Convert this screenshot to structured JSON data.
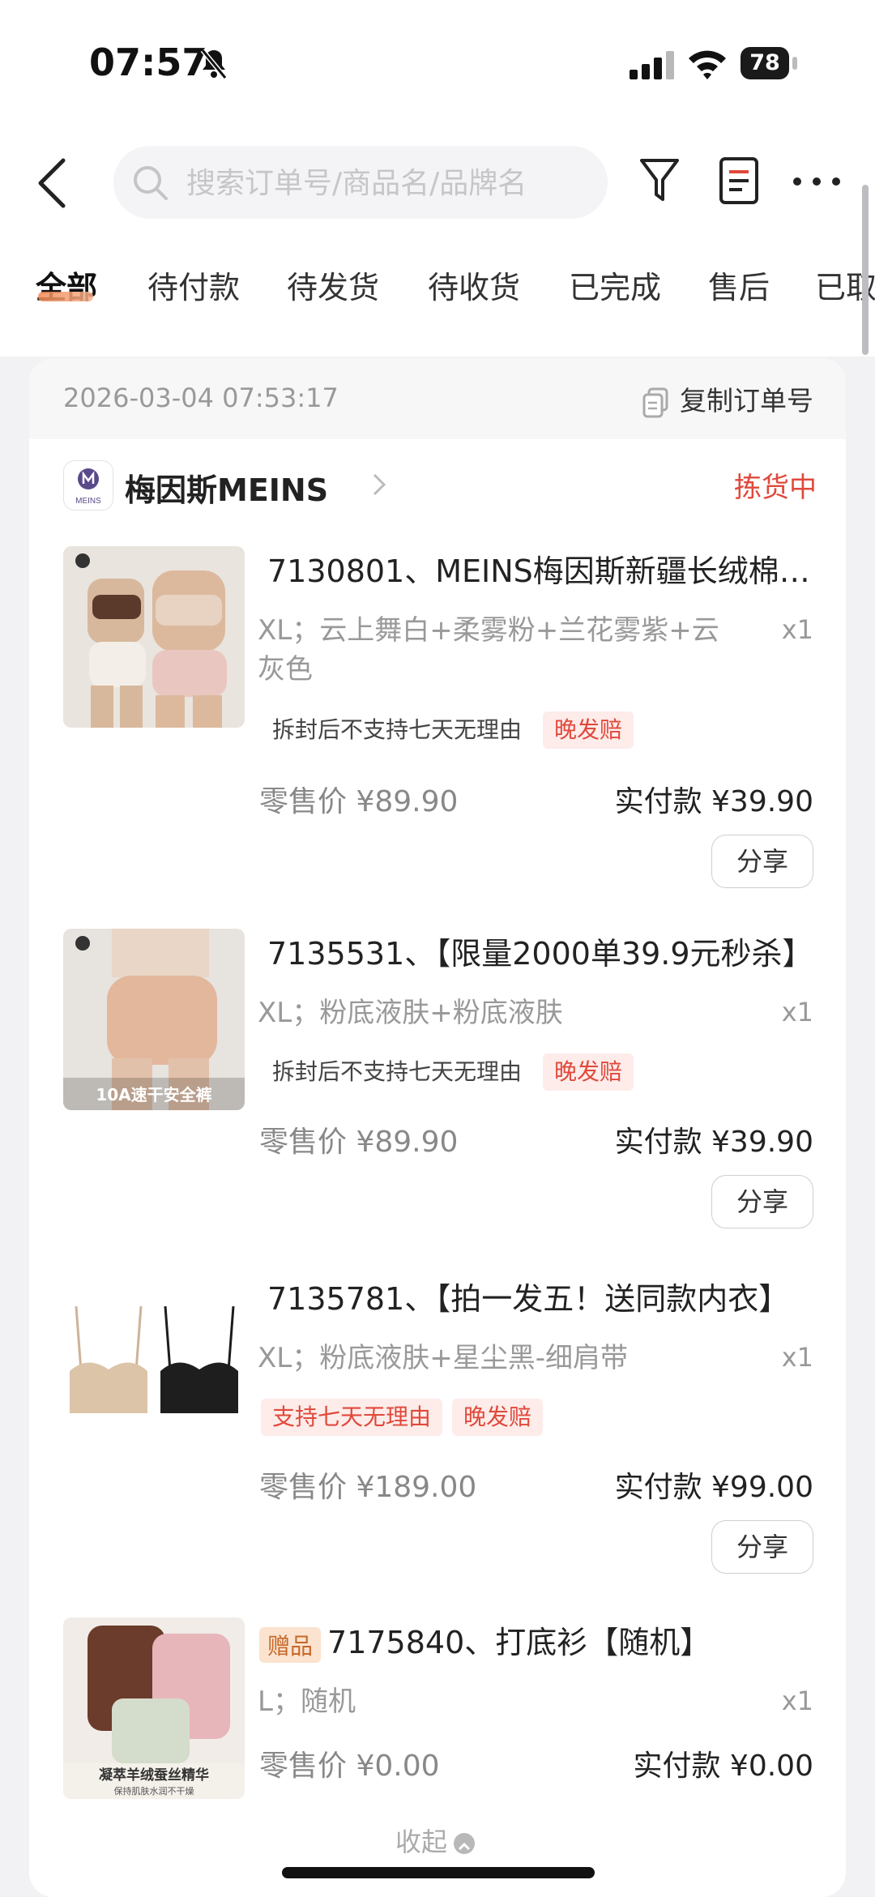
{
  "status_bar": {
    "time": "07:57",
    "battery": "78"
  },
  "search": {
    "placeholder": "搜索订单号/商品名/品牌名"
  },
  "tabs": [
    "全部",
    "待付款",
    "待发货",
    "待收货",
    "已完成",
    "售后",
    "已取"
  ],
  "order": {
    "datetime": "2026-03-04 07:53:17",
    "copy_label": "复制订单号",
    "shop_name": "梅因斯MEINS",
    "shop_logo_text": "MEINS",
    "status": "拣货中",
    "items": [
      {
        "title": "7130801、MEINS梅因斯新疆长绒棉…",
        "spec": "XL；云上舞白+柔雾粉+兰花雾紫+云灰色",
        "qty": "x1",
        "badges": [
          "拆封后不支持七天无理由",
          "晚发赔"
        ],
        "retail": "零售价 ¥89.90",
        "paid": "实付款 ¥39.90",
        "share": "分享"
      },
      {
        "title": "7135531、【限量2000单39.9元秒杀】",
        "spec": "XL；粉底液肤+粉底液肤",
        "qty": "x1",
        "thumb_caption": "10A速干安全裤",
        "badges": [
          "拆封后不支持七天无理由",
          "晚发赔"
        ],
        "retail": "零售价 ¥89.90",
        "paid": "实付款 ¥39.90",
        "share": "分享"
      },
      {
        "title": "7135781、【拍一发五！送同款内衣】",
        "spec": "XL；粉底液肤+星尘黑-细肩带",
        "qty": "x1",
        "badges": [
          "支持七天无理由",
          "晚发赔"
        ],
        "retail": "零售价 ¥189.00",
        "paid": "实付款 ¥99.00",
        "share": "分享"
      },
      {
        "gift_tag": "赠品",
        "title": "7175840、打底衫【随机】",
        "spec": "L；随机",
        "qty": "x1",
        "thumb_caption": "凝萃羊绒蚕丝精华",
        "thumb_subcaption": "保持肌肤水润不干燥",
        "retail": "零售价 ¥0.00",
        "paid": "实付款 ¥0.00"
      }
    ],
    "collapse_label": "收起"
  },
  "colors": {
    "accent_red": "#e0493b",
    "tab_underline": "#f28a55",
    "gift_bg": "#fbe3cf"
  }
}
